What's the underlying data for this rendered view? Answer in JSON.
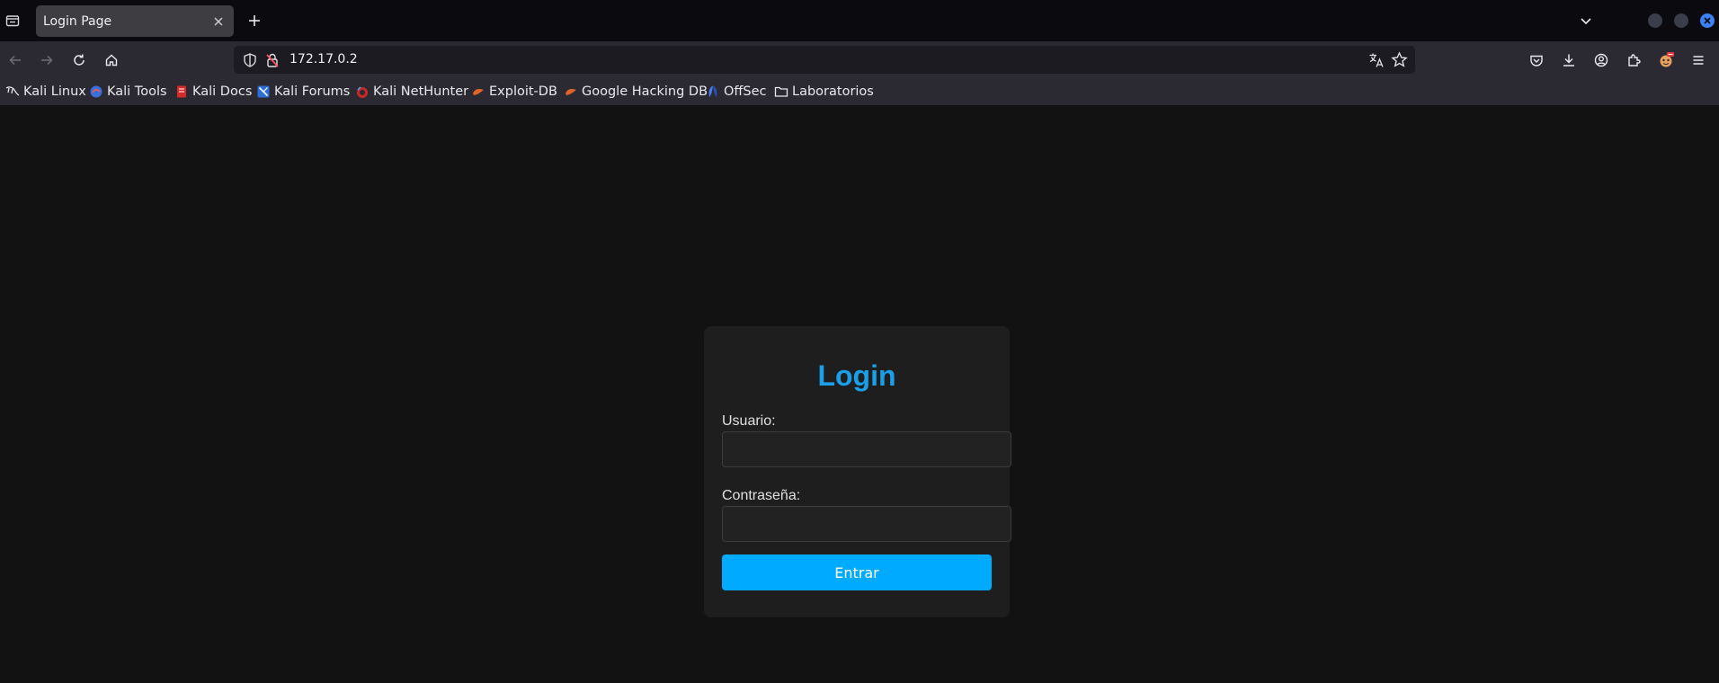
{
  "browser": {
    "tab": {
      "title": "Login Page"
    },
    "url": "172.17.0.2",
    "bookmarks": [
      {
        "label": "Kali Linux",
        "icon": "kali-dragon-icon"
      },
      {
        "label": "Kali Tools",
        "icon": "kali-tools-icon"
      },
      {
        "label": "Kali Docs",
        "icon": "kali-docs-icon"
      },
      {
        "label": "Kali Forums",
        "icon": "kali-forums-icon"
      },
      {
        "label": "Kali NetHunter",
        "icon": "kali-nethunter-icon"
      },
      {
        "label": "Exploit-DB",
        "icon": "exploit-db-icon"
      },
      {
        "label": "Google Hacking DB",
        "icon": "ghdb-icon"
      },
      {
        "label": "OffSec",
        "icon": "offsec-icon"
      },
      {
        "label": "Laboratorios",
        "icon": "folder-icon"
      }
    ],
    "colors": {
      "accent": "#3b82f6",
      "toolbar": "#2b2a33",
      "tabstrip": "#0b0b0f"
    }
  },
  "page": {
    "title": "Login",
    "username_label": "Usuario:",
    "username_value": "",
    "password_label": "Contraseña:",
    "password_value": "",
    "submit_label": "Entrar",
    "colors": {
      "title": "#1a9fe8",
      "button": "#00aaff",
      "card": "#1e1e1e",
      "background": "#121212"
    }
  }
}
